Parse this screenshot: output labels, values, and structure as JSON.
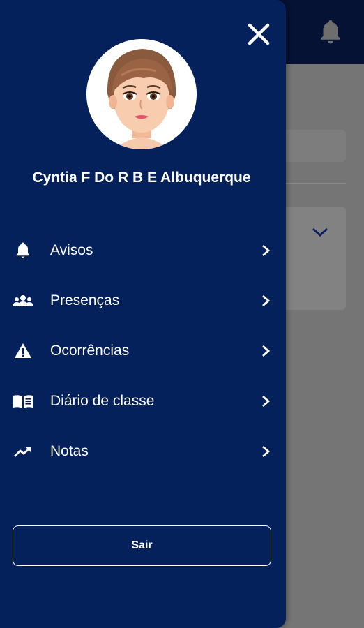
{
  "user": {
    "name": "Cyntia F Do R B E Albuquerque",
    "avatar_icon": "avatar-illustration"
  },
  "menu": [
    {
      "label": "Avisos",
      "icon": "bell-icon"
    },
    {
      "label": "Presenças",
      "icon": "people-icon"
    },
    {
      "label": "Ocorrências",
      "icon": "warning-icon"
    },
    {
      "label": "Diário de classe",
      "icon": "book-icon"
    },
    {
      "label": "Notas",
      "icon": "trending-up-icon"
    }
  ],
  "logout_label": "Sair",
  "colors": {
    "drawer": "#04215c",
    "header": "#061233",
    "overlay": "#757575",
    "text": "#ffffff"
  }
}
